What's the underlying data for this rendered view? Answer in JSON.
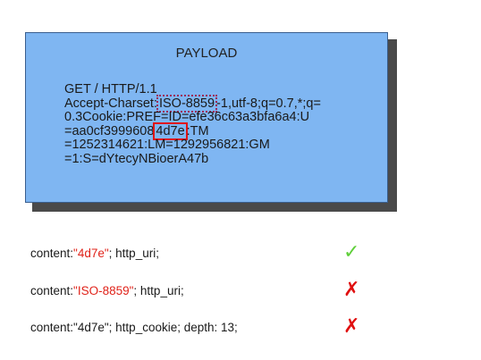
{
  "payload": {
    "title": "PAYLOAD",
    "line1": "GET / HTTP/1.1",
    "line2_pre": "Accept-Charset:",
    "line2_hl": "ISO-8859",
    "line2_post": "-1,utf-8;q=0.7,*;q=",
    "line3": "0.3Cookie:PREF=ID=efe36c63a3bfa6a4:U",
    "line4_pre": "=aa0cf3999608",
    "line4_hl": "4d7e",
    "line4_post": ":TM",
    "line5": "=1252314621:LM=1292956821:GM",
    "line6": "=1:S=dYtecyNBioerA47b"
  },
  "rules": [
    {
      "prefix": "content:",
      "quoted": "\"4d7e\"",
      "suffix": "; http_uri;",
      "result": "✓"
    },
    {
      "prefix": "content:",
      "quoted": "\"ISO-8859\"",
      "suffix": "; http_uri;",
      "result": "✗"
    },
    {
      "prefix": "content:",
      "quoted": "\"4d7e\"",
      "suffix": "; http_cookie; depth: 13;",
      "result": "✗"
    }
  ],
  "colors": {
    "payload_bg": "#7fb6f2",
    "highlight_iso": "#9a2a5a",
    "highlight_4d7e": "#e01515",
    "check": "#5fcf3a",
    "cross": "#e01010",
    "quoted_red": "#e0231a"
  }
}
